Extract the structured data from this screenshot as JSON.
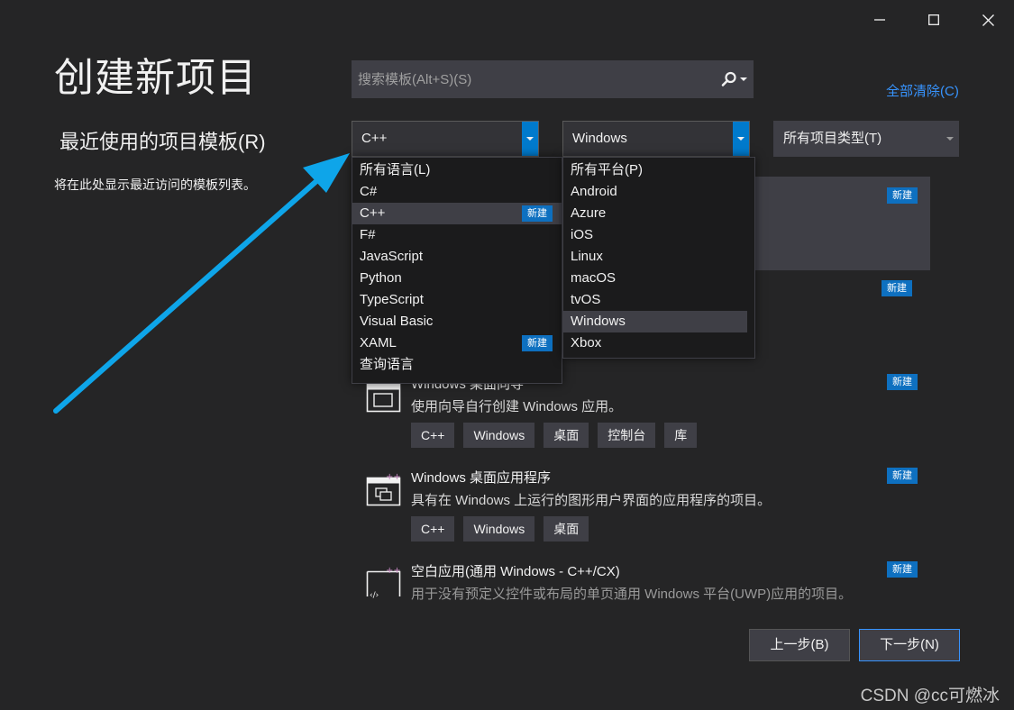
{
  "page_title": "创建新项目",
  "recent": {
    "title": "最近使用的项目模板(R)",
    "empty_message": "将在此处显示最近访问的模板列表。"
  },
  "search": {
    "placeholder": "搜索模板(Alt+S)(S)"
  },
  "clear_all": "全部清除(C)",
  "filters": {
    "language": {
      "selected": "C++",
      "options": [
        {
          "label": "所有语言(L)",
          "badge": ""
        },
        {
          "label": "C#",
          "badge": ""
        },
        {
          "label": "C++",
          "badge": "新建"
        },
        {
          "label": "F#",
          "badge": ""
        },
        {
          "label": "JavaScript",
          "badge": ""
        },
        {
          "label": "Python",
          "badge": ""
        },
        {
          "label": "TypeScript",
          "badge": ""
        },
        {
          "label": "Visual Basic",
          "badge": ""
        },
        {
          "label": "XAML",
          "badge": "新建"
        },
        {
          "label": "查询语言",
          "badge": ""
        }
      ]
    },
    "platform": {
      "selected": "Windows",
      "options": [
        "所有平台(P)",
        "Android",
        "Azure",
        "iOS",
        "Linux",
        "macOS",
        "tvOS",
        "Windows",
        "Xbox"
      ]
    },
    "project_type": {
      "selected": "所有项目类型(T)"
    }
  },
  "badge_new": "新建",
  "templates": [
    {
      "name": "Windows 桌面向导",
      "description": "使用向导自行创建 Windows 应用。",
      "tags": [
        "C++",
        "Windows",
        "桌面",
        "控制台",
        "库"
      ]
    },
    {
      "name": "Windows 桌面应用程序",
      "description": "具有在 Windows 上运行的图形用户界面的应用程序的项目。",
      "tags": [
        "C++",
        "Windows",
        "桌面"
      ]
    },
    {
      "name": "空白应用(通用 Windows - C++/CX)",
      "description": "用于没有预定义控件或布局的单页通用 Windows 平台(UWP)应用的项目。",
      "tags": []
    }
  ],
  "buttons": {
    "back": "上一步(B)",
    "next": "下一步(N)"
  },
  "watermark": "CSDN @cc可燃冰",
  "colors": {
    "background": "#252526",
    "accent": "#007acc",
    "annotation_arrow": "#0ea5e9",
    "link": "#3794ff"
  },
  "icons": {
    "minimize": "minimize-icon",
    "maximize": "maximize-icon",
    "close": "close-icon",
    "search": "search-icon",
    "dropdown": "chevron-down-icon",
    "annotation": "annotation-arrow"
  }
}
